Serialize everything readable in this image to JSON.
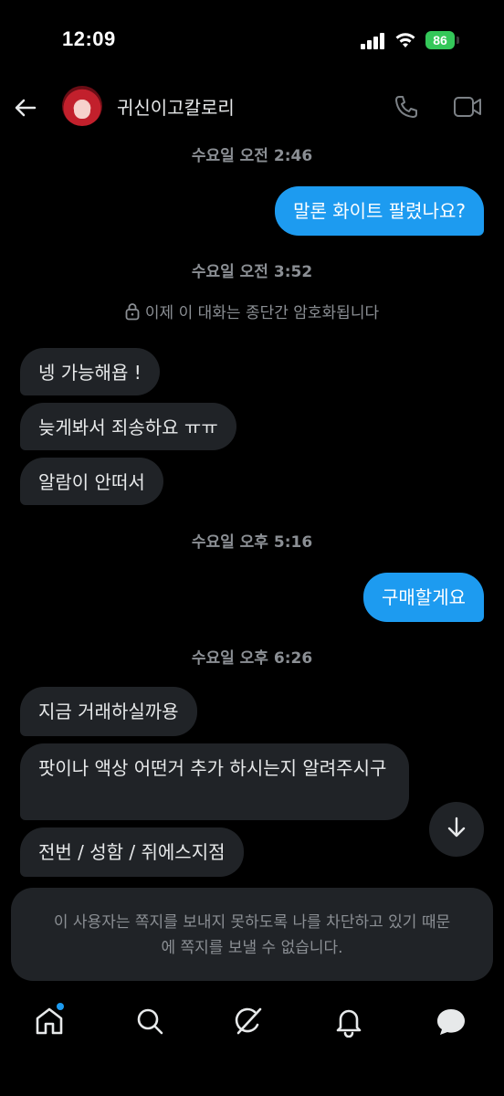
{
  "status_bar": {
    "time": "12:09",
    "battery": "86"
  },
  "header": {
    "name": "귀신이고칼로리"
  },
  "messages": {
    "ts1": "수요일 오전 2:46",
    "out1": "말론 화이트 팔렸나요?",
    "ts2": "수요일 오전 3:52",
    "encryption_notice": "이제 이 대화는 종단간 암호화됩니다",
    "in1": "넹 가능해욥 !",
    "in2": "늦게봐서 죄송하요 ㅠㅠ",
    "in3": "알람이 안떠서",
    "ts3": "수요일 오후 5:16",
    "out2": "구매할게요",
    "ts4": "수요일 오후 6:26",
    "in4": "지금 거래하실까용",
    "in5": "팟이나 액상 어떤거 추가 하시는지 알려주시구",
    "in6": "전번 / 성함 / 쥐에스지점"
  },
  "blocked_notice": "이 사용자는 쪽지를 보내지 못하도록 나를 차단하고 있기 때문에 쪽지를 보낼 수 없습니다.",
  "nav": [
    "home-icon",
    "search-icon",
    "grok-icon",
    "notifications-icon",
    "messages-icon"
  ],
  "colors": {
    "accent": "#1d9bf0",
    "incoming_bubble": "#202327",
    "background": "#000000",
    "battery": "#34c759"
  }
}
